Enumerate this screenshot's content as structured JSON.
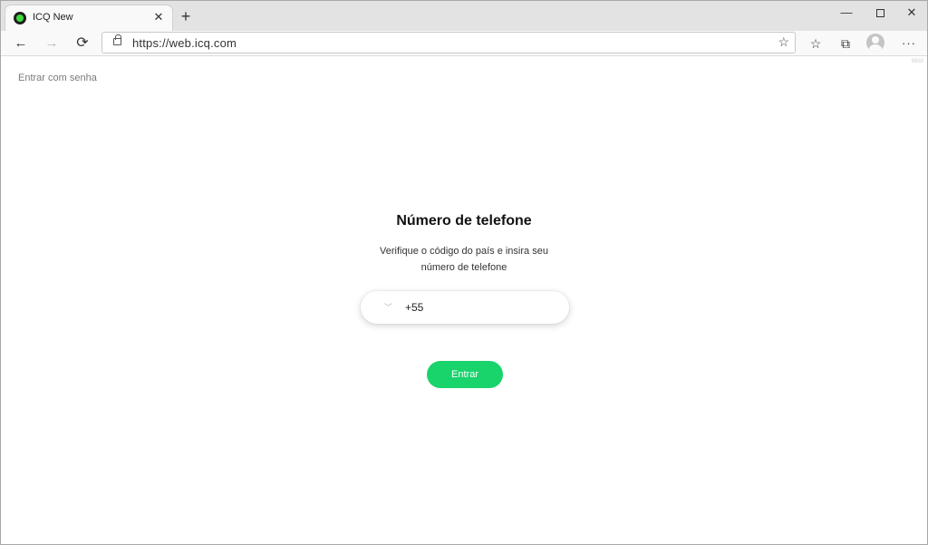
{
  "browser": {
    "tab": {
      "title": "ICQ New",
      "close_glyph": "✕",
      "favicon": "icq-flower-icon"
    },
    "new_tab_glyph": "+",
    "window_controls": {
      "minimize": "—",
      "close": "✕"
    },
    "nav": {
      "back": "←",
      "forward": "→",
      "reload": "⟳"
    },
    "address": {
      "url": "https://web.icq.com",
      "star": "☆"
    },
    "toolbar_icons": {
      "favorites": "☆",
      "collections": "⧉",
      "more": "···"
    }
  },
  "page": {
    "corner_mark": "9850",
    "password_link": "Entrar com senha",
    "heading": "Número de telefone",
    "subtitle": "Verifique o código do país e insira seu número de telefone",
    "phone": {
      "country_code": "+55",
      "value": "",
      "placeholder": "",
      "chevron": "﹀"
    },
    "enter_label": "Entrar",
    "accent_color": "#19d36b"
  }
}
